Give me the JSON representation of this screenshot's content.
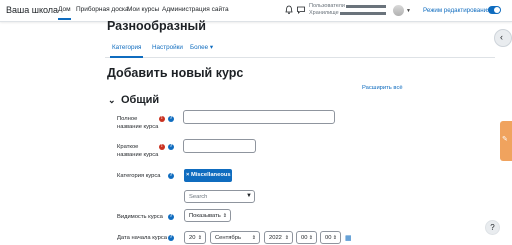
{
  "navbar": {
    "brand": "Ваша школа",
    "links": [
      "Дом",
      "Приборная доска",
      "Мои курсы",
      "Администрация сайта"
    ],
    "user_lines": [
      "Пользователи",
      "Хранилище"
    ],
    "edit_mode_label": "Режим редактирования",
    "edit_mode_on": true
  },
  "page": {
    "title": "Разнообразный",
    "tabs": [
      "Категория",
      "Настройки",
      "Более ▾"
    ],
    "heading": "Добавить новый курс",
    "expand_all": "Расширить всё",
    "section_title": "Общий"
  },
  "form": {
    "full_name_label": [
      "Полное",
      "название курса"
    ],
    "short_name_label": [
      "Краткое",
      "название курса"
    ],
    "category_label": "Категория курса",
    "category_chip": "× Miscellaneous",
    "search_placeholder": "Search",
    "visibility_label": "Видимость курса",
    "visibility_value": "Показывать",
    "start_date_label": "Дата начала курса",
    "start_day": "20",
    "start_month": "Сентябрь",
    "start_year": "2022",
    "start_hour": "00",
    "start_minute": "00"
  },
  "colors": {
    "accent": "#0f6cbf",
    "required": "#ca3120",
    "feedback": "#f0a35e"
  },
  "icons": [
    "bell-icon",
    "chat-icon",
    "chevron-left-icon",
    "calendar-icon",
    "help-icon"
  ]
}
